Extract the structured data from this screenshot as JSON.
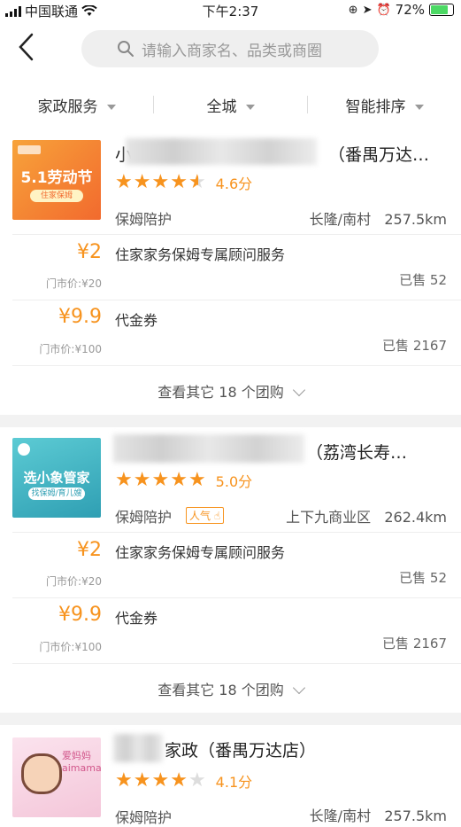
{
  "status_bar": {
    "carrier": "中国联通",
    "time": "下午2:37",
    "battery": "72%"
  },
  "search": {
    "placeholder": "请输入商家名、品类或商圈"
  },
  "filters": [
    {
      "label": "家政服务"
    },
    {
      "label": "全城"
    },
    {
      "label": "智能排序"
    }
  ],
  "merchants": [
    {
      "name_prefix": "小",
      "name_suffix": "（番禺万达…",
      "rating": 4.6,
      "rating_text": "4.6分",
      "category": "保姆陪护",
      "badge": "",
      "area": "长隆/南村",
      "distance": "257.5km",
      "thumb": {
        "line1": "5.1劳动节",
        "line2": "住家保姆"
      },
      "deals": [
        {
          "price": "¥2",
          "original": "门市价:¥20",
          "title": "住家家务保姆专属顾问服务",
          "sold": "已售 52"
        },
        {
          "price": "¥9.9",
          "original": "门市价:¥100",
          "title": "代金券",
          "sold": "已售 2167"
        }
      ],
      "more": "查看其它 18 个团购"
    },
    {
      "name_prefix": "",
      "name_suffix": "（荔湾长寿…",
      "rating": 5.0,
      "rating_text": "5.0分",
      "category": "保姆陪护",
      "badge": "人气",
      "area": "上下九商业区",
      "distance": "262.4km",
      "thumb": {
        "line1": "选小象管家",
        "line2": "找保姆/育儿嫂"
      },
      "deals": [
        {
          "price": "¥2",
          "original": "门市价:¥20",
          "title": "住家家务保姆专属顾问服务",
          "sold": "已售 52"
        },
        {
          "price": "¥9.9",
          "original": "门市价:¥100",
          "title": "代金券",
          "sold": "已售 2167"
        }
      ],
      "more": "查看其它 18 个团购"
    },
    {
      "name_prefix": "",
      "name_suffix": "家政（番禺万达店）",
      "rating": 4.1,
      "rating_text": "4.1分",
      "category": "保姆陪护",
      "badge": "",
      "area": "长隆/南村",
      "distance": "257.5km",
      "thumb": {
        "line1": "爱妈妈",
        "line2": "aimama"
      }
    }
  ],
  "colors": {
    "accent": "#f7931e",
    "divider": "#f2f2f2"
  }
}
